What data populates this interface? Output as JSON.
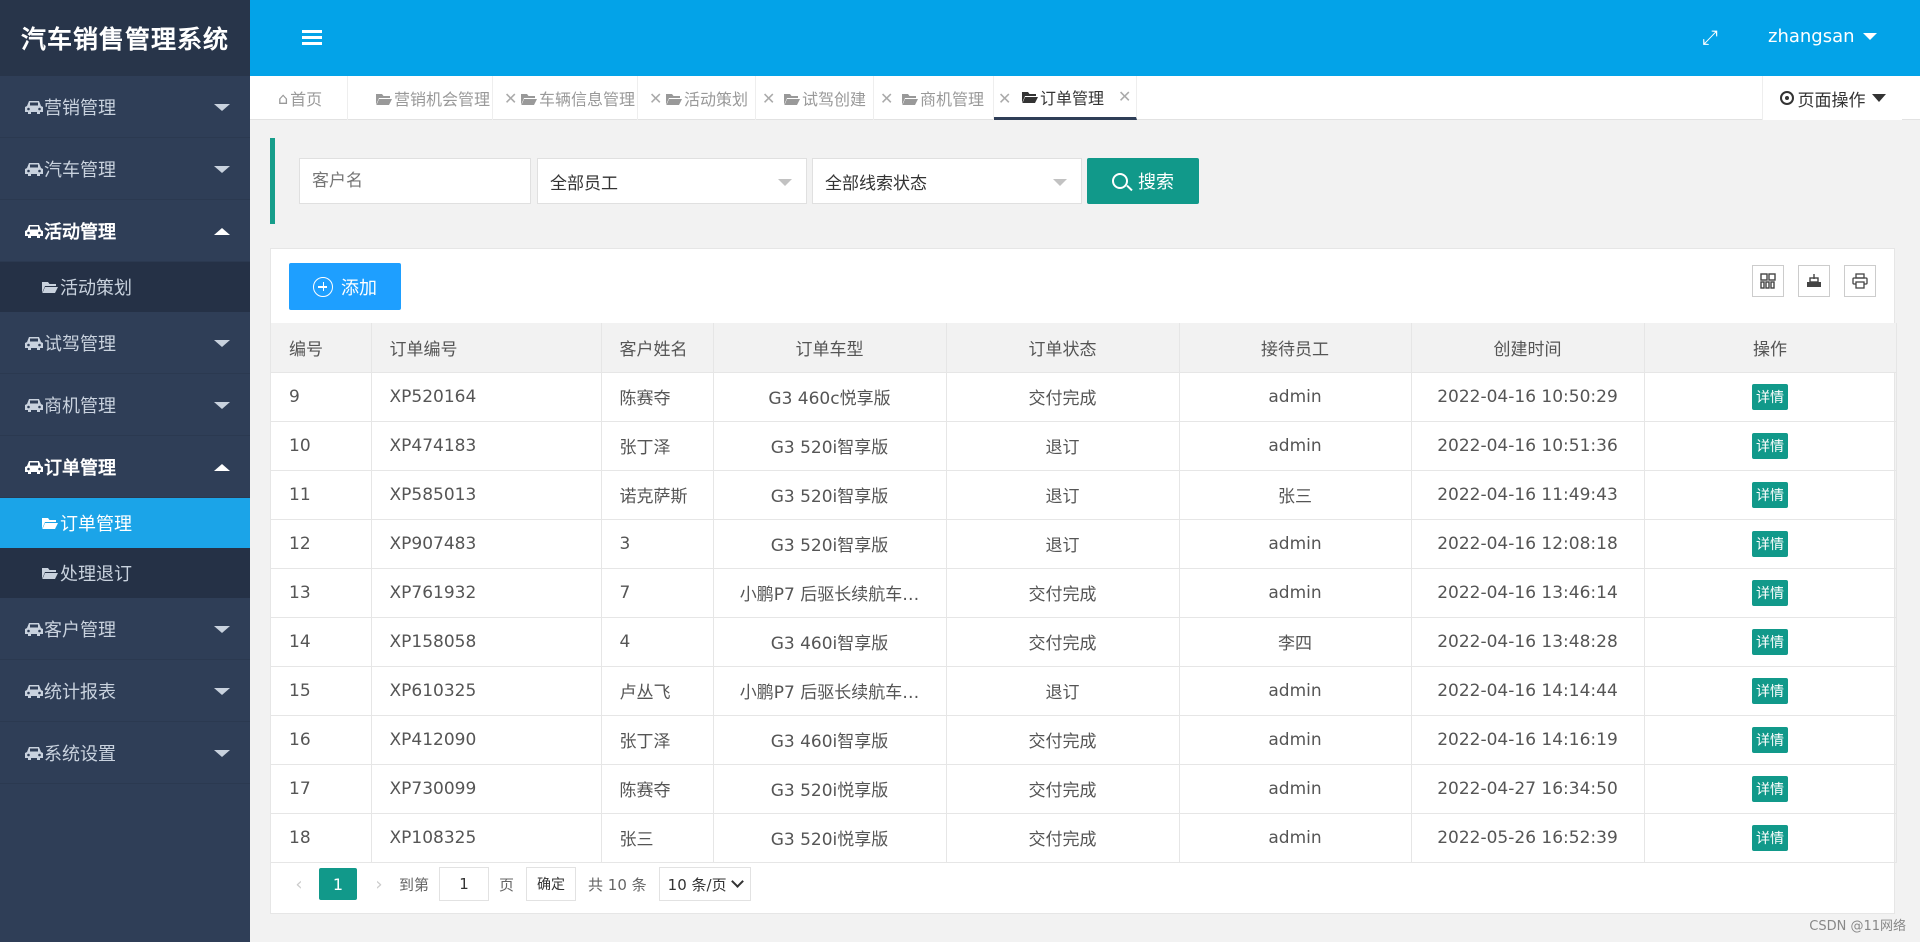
{
  "sidebar": {
    "brand": "汽车销售管理系统",
    "items": [
      {
        "label": "营销管理",
        "open": false
      },
      {
        "label": "汽车管理",
        "open": false
      },
      {
        "label": "活动管理",
        "open": true,
        "children": [
          "活动策划"
        ]
      },
      {
        "label": "试驾管理",
        "open": false
      },
      {
        "label": "商机管理",
        "open": false
      },
      {
        "label": "订单管理",
        "open": true,
        "children": [
          "订单管理",
          "处理退订"
        ]
      },
      {
        "label": "客户管理",
        "open": false
      },
      {
        "label": "统计报表",
        "open": false
      },
      {
        "label": "系统设置",
        "open": false
      }
    ],
    "active_child": "订单管理"
  },
  "header": {
    "username": "zhangsan",
    "accent": "#03a3e8"
  },
  "tabs": [
    {
      "label": "首页",
      "closable": false,
      "icon": "home-icon"
    },
    {
      "label": "营销机会管理",
      "closable": true,
      "icon": "folder-icon"
    },
    {
      "label": "车辆信息管理",
      "closable": true,
      "icon": "folder-icon"
    },
    {
      "label": "活动策划",
      "closable": true,
      "icon": "folder-icon"
    },
    {
      "label": "试驾创建",
      "closable": true,
      "icon": "folder-icon"
    },
    {
      "label": "商机管理",
      "closable": true,
      "icon": "folder-icon"
    },
    {
      "label": "订单管理",
      "closable": true,
      "icon": "folder-open-icon",
      "active": true
    }
  ],
  "page_ops": "页面操作",
  "search": {
    "customer_placeholder": "客户名",
    "staff_select": "全部员工",
    "status_select": "全部线索状态",
    "search_label": "搜索"
  },
  "toolbar": {
    "add_label": "添加"
  },
  "table": {
    "columns": [
      "编号",
      "订单编号",
      "客户姓名",
      "订单车型",
      "订单状态",
      "接待员工",
      "创建时间",
      "操作"
    ],
    "detail_label": "详情",
    "rows": [
      [
        "9",
        "XP520164",
        "陈赛夺",
        "G3 460c悦享版",
        "交付完成",
        "admin",
        "2022-04-16 10:50:29"
      ],
      [
        "10",
        "XP474183",
        "张丁泽",
        "G3 520i智享版",
        "退订",
        "admin",
        "2022-04-16 10:51:36"
      ],
      [
        "11",
        "XP585013",
        "诺克萨斯",
        "G3 520i智享版",
        "退订",
        "张三",
        "2022-04-16 11:49:43"
      ],
      [
        "12",
        "XP907483",
        "3",
        "G3 520i智享版",
        "退订",
        "admin",
        "2022-04-16 12:08:18"
      ],
      [
        "13",
        "XP761932",
        "7",
        "小鹏P7 后驱长续航车…",
        "交付完成",
        "admin",
        "2022-04-16 13:46:14"
      ],
      [
        "14",
        "XP158058",
        "4",
        "G3 460i智享版",
        "交付完成",
        "李四",
        "2022-04-16 13:48:28"
      ],
      [
        "15",
        "XP610325",
        "卢丛飞",
        "小鹏P7 后驱长续航车…",
        "退订",
        "admin",
        "2022-04-16 14:14:44"
      ],
      [
        "16",
        "XP412090",
        "张丁泽",
        "G3 460i智享版",
        "交付完成",
        "admin",
        "2022-04-16 14:16:19"
      ],
      [
        "17",
        "XP730099",
        "陈赛夺",
        "G3 520i悦享版",
        "交付完成",
        "admin",
        "2022-04-27 16:34:50"
      ],
      [
        "18",
        "XP108325",
        "张三",
        "G3 520i悦享版",
        "交付完成",
        "admin",
        "2022-05-26 16:52:39"
      ]
    ]
  },
  "pager": {
    "current": "1",
    "goto_label": "到第",
    "goto_value": "1",
    "page_unit": "页",
    "confirm_label": "确定",
    "total_label": "共 10 条",
    "page_size": "10 条/页"
  },
  "watermark": "CSDN @11网络"
}
